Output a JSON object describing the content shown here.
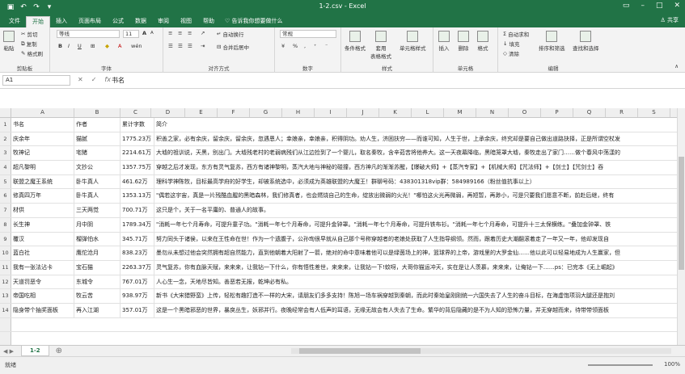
{
  "titlebar": {
    "title": "1-2.csv  -  Excel",
    "qat": [
      "save-icon",
      "undo-icon",
      "redo-icon",
      "customize-icon"
    ]
  },
  "tabs": [
    "文件",
    "开始",
    "插入",
    "页面布局",
    "公式",
    "数据",
    "审阅",
    "视图",
    "帮助"
  ],
  "active_tab": "开始",
  "tellme": "告诉我你想要做什么",
  "share": "共享",
  "ribbon": {
    "clipboard": {
      "label": "剪贴板",
      "paste": "粘贴",
      "cut": "剪切",
      "copy": "复制",
      "painter": "格式刷"
    },
    "font": {
      "label": "字体",
      "name": "等线",
      "size": "11",
      "grow": "A",
      "shrink": "A",
      "bold": "B",
      "italic": "I",
      "underline": "U",
      "wen": "wén"
    },
    "alignment": {
      "label": "对齐方式",
      "wrap": "自动换行",
      "merge": "合并后居中"
    },
    "number": {
      "label": "数字",
      "format": "常规",
      "percent": "%",
      "comma": ","
    },
    "styles": {
      "label": "样式",
      "conditional": "条件格式",
      "table": "套用\n表格格式",
      "cell_styles": "单元格样式"
    },
    "cells": {
      "label": "单元格",
      "insert": "插入",
      "delete": "删除",
      "format": "格式"
    },
    "editing": {
      "label": "编辑",
      "autosum": "自动求和",
      "fill": "填充",
      "clear": "清除",
      "sort": "排序和筛选",
      "find": "查找和选择"
    }
  },
  "formula_bar": {
    "name_box": "A1",
    "value": "书名",
    "fx": "fx"
  },
  "columns": [
    "A",
    "B",
    "C",
    "D",
    "E",
    "F",
    "G",
    "H",
    "I",
    "J",
    "K",
    "L",
    "M",
    "N",
    "O",
    "P",
    "Q",
    "R",
    "S",
    "T",
    "U"
  ],
  "rows": [
    {
      "n": "1",
      "a": "书名",
      "b": "作者",
      "c": "累计字数",
      "d": "简介"
    },
    {
      "n": "2",
      "a": "庆余年",
      "b": "猫腻",
      "c": "1775.23万",
      "d": "积善之家，必有余庆，留余庆，留余庆，忽遇恩人；幸娘亲，幸娘亲，积得阴功。劝人生，济困扶穷——而谁可知，人生于世，上承余庆，终究却是要自己做出道路抉择，正是所谓空杖发"
    },
    {
      "n": "3",
      "a": "牧神记",
      "b": "宅猪",
      "c": "2214.61万",
      "d": "大墟的祖训说，天黑，别出门。大墟残老村的老弱病残们从江边捡到了一个婴儿，取名秦牧，含辛茹苦将他养大。这一天夜幕降临，黑暗笼罩大墟，秦牧走出了家门……做个春风中荡漾的"
    },
    {
      "n": "4",
      "a": "超凡黎明",
      "b": "文抄公",
      "c": "1357.75万",
      "d": "穿越之后才发现，东方有灵气复苏，西方有诸神黎明，蒸汽大地与神秘的碰撞，西方神凡的渐渐苏醒，【爆破大师】+【蒸汽专家】+【机械大师】【咒法师】+【剑士】【咒剑士】吞"
    },
    {
      "n": "5",
      "a": "联盟之魔王系统",
      "b": "卧牛真人",
      "c": "461.62万",
      "d": "理科学神陈牧，目标最高学府的好学生，却被系统选中，必须成为英雄联盟的大魔王！群聊号码：438301318vip群：584989166（粉丝值抗事以上）"
    },
    {
      "n": "6",
      "a": "修真四万年",
      "b": "卧牛真人",
      "c": "1353.13万",
      "d": "\"偶若这宇宙，真是一片残酷血腥的黑暗森林，我们修真者，也会燃烧自己的生命，绽放出微弱的火光！\"哪怕这火光再微弱，再短暂，再渺小，可是只要我们愿意不断，前赴后继，终有"
    },
    {
      "n": "7",
      "a": "材供",
      "b": "三天两觉",
      "c": "700.71万",
      "d": "这只是个，关于一名平庸的、普通人的故事。"
    },
    {
      "n": "8",
      "a": "长生神",
      "b": "月中阴",
      "c": "1789.34万",
      "d": "\"消耗一年七个月寿命，可提升童子功。\"消耗一年七个月寿命，可提升金钟罩。\"消耗一年七个月寿命，可提升铁布衫。\"消耗一年七个月寿命，可提升十三太保横练。\"叠加金钟罩、铁"
    },
    {
      "n": "9",
      "a": "覆汉",
      "b": "榴弹怕水",
      "c": "345.71万",
      "d": "努力同头于诸侯，以来在王性命在世！作为一个遗腹子，公孙珣很早就从自己那个号称穿越者的老娘处获取了人生指导纲领。然而，跟着历史大潮翻滚着走了一年又一年，他却发现自"
    },
    {
      "n": "10",
      "a": "蓝白社",
      "b": "鹰佗沧月",
      "c": "838.23万",
      "d": "墨勿从未想过他会突然拥有超自然能力，直到他朝着大阳射了一箭，绝对的命中意味着他可以是绿茵场上的神，篮球界的上帝，游戏里的大罗金仙……他以此可以轻易地成为人生赢家，但"
    },
    {
      "n": "11",
      "a": "我有一张法沾卡",
      "b": "宝石猫",
      "c": "2263.37万",
      "d": "灵气复苏，你有血脉天赋，来来来，让我钻一下什么，你有悟性差世，来来来，让我钻一下!蚊呀，大哥你猫运冲天，实在是让人羡慕，来来来，让俺钻一下……ps：已完本《无上崛起》"
    },
    {
      "n": "12",
      "a": "天道罚恶令",
      "b": "东城令",
      "c": "767.01万",
      "d": "人心生一念，天地尽皆知。善恶若无报，乾坤必有私。"
    },
    {
      "n": "13",
      "a": "帝国吃相",
      "b": "牧云苦",
      "c": "938.97万",
      "d": "新书《大宋猎野蛮》上传，轻松有趣打造不一样的大宋，请朋友们多多支持！陈旭一场车祸穿越到秦朝，而此时秦始皇刚刚统一六国失去了人生的奋斗目标，在海虚饱项羽大腿还是抱刘"
    },
    {
      "n": "14",
      "a": "隐身带个抽奖面板",
      "b": "再入江湖",
      "c": "357.01万",
      "d": "这是一个黑暗邪恶的世界，暴戾丛生，妖邪并行。夜晚经常会有人低声的耳语，无缘无故会有人失去了生命。繁华的背后隐藏的是不为人知的恐怖力量，并无穿越而来，待带带领面板"
    }
  ],
  "sheet": {
    "name": "1-2"
  },
  "status": {
    "ready": "就绪",
    "zoom": "100%"
  }
}
